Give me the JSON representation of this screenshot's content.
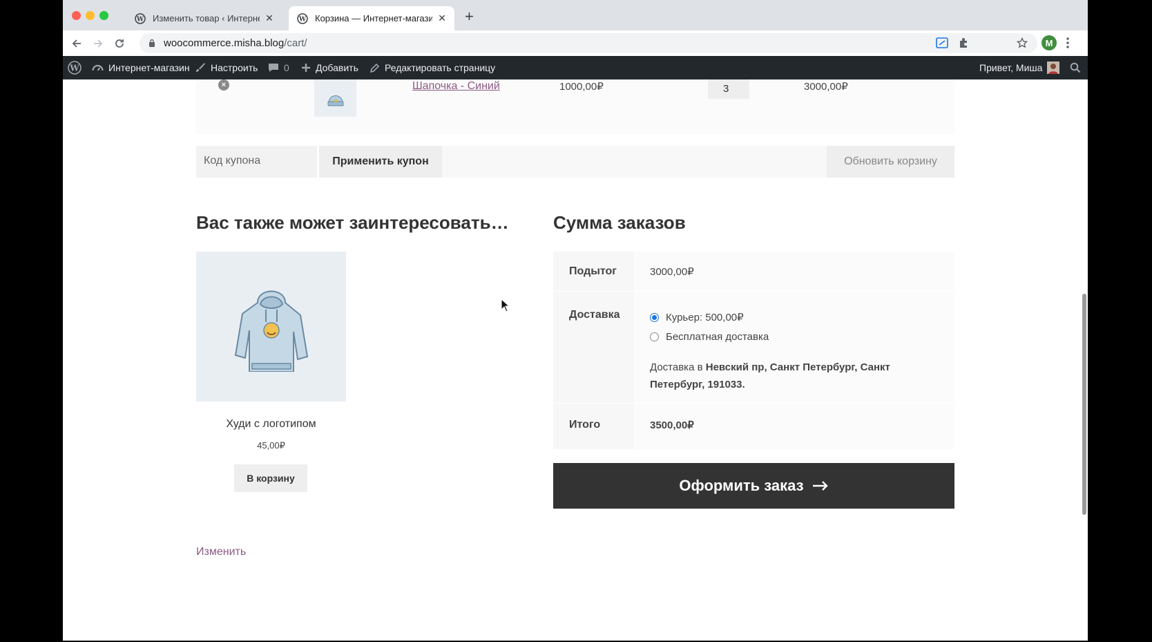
{
  "browser": {
    "tabs": [
      {
        "title": "Изменить товар ‹ Интернет-м"
      },
      {
        "title": "Корзина — Интернет-магази"
      }
    ],
    "url_host": "woocommerce.misha.blog",
    "url_path": "/cart/",
    "profile_initial": "M"
  },
  "adminbar": {
    "site_name": "Интернет-магазин",
    "customize": "Настроить",
    "comments_count": "0",
    "new": "Добавить",
    "edit_page": "Редактировать страницу",
    "greeting": "Привет, Миша"
  },
  "cart": {
    "item": {
      "name": "Шапочка - Синий",
      "price": "1000,00₽",
      "quantity": "3",
      "subtotal": "3000,00₽"
    },
    "coupon_placeholder": "Код купона",
    "apply_coupon": "Применить купон",
    "update_cart": "Обновить корзину"
  },
  "cross_sells": {
    "heading": "Вас также может заинтересовать…",
    "product": {
      "name": "Худи с логотипом",
      "price": "45,00₽",
      "add_to_cart": "В корзину"
    }
  },
  "totals": {
    "heading": "Сумма заказов",
    "subtotal_label": "Подытог",
    "subtotal_value": "3000,00₽",
    "shipping_label": "Доставка",
    "shipping_options": [
      {
        "label": "Курьер: 500,00₽",
        "checked": true
      },
      {
        "label": "Бесплатная доставка",
        "checked": false
      }
    ],
    "destination_prefix": "Доставка в",
    "destination": "Невский пр, Санкт Петербург, Санкт Петербург, 191033.",
    "total_label": "Итого",
    "total_value": "3500,00₽",
    "checkout": "Оформить заказ"
  },
  "edit_link": "Изменить",
  "colors": {
    "link": "#8b5a83",
    "adminbar_bg": "#23282d",
    "checkout_bg": "#333333"
  }
}
